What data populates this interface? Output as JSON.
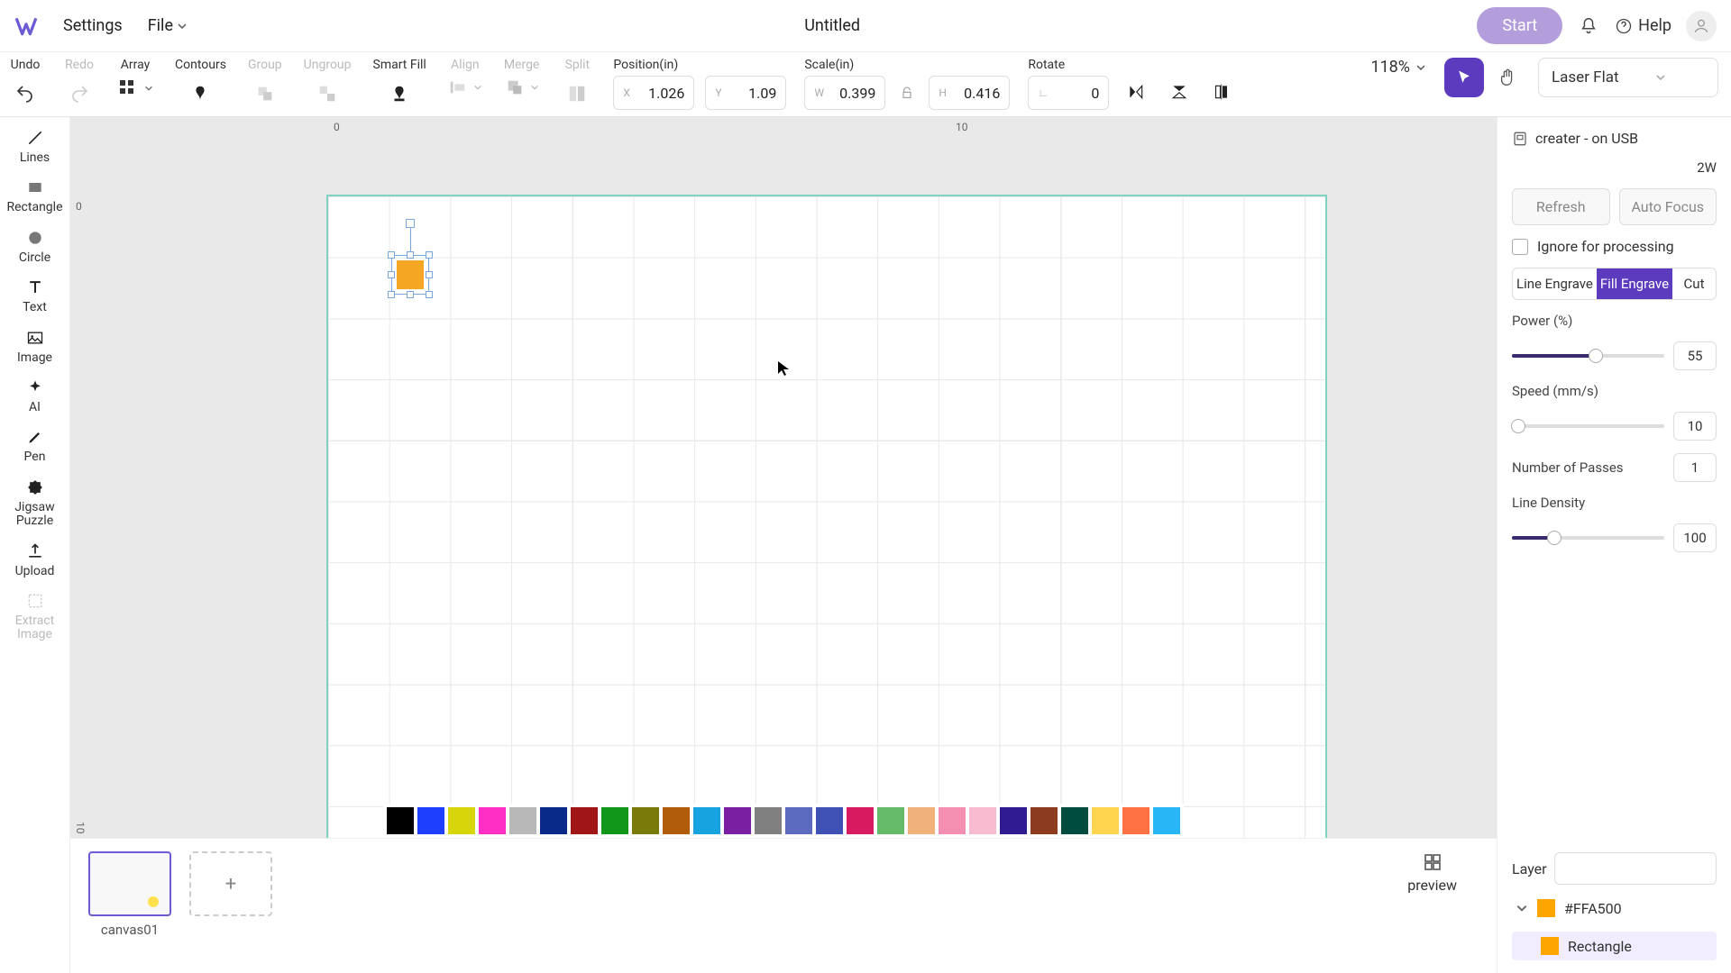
{
  "menubar": {
    "settings": "Settings",
    "file": "File",
    "title": "Untitled",
    "start": "Start",
    "help": "Help"
  },
  "toolbar": {
    "undo": "Undo",
    "redo": "Redo",
    "array": "Array",
    "contours": "Contours",
    "group": "Group",
    "ungroup": "Ungroup",
    "smart_fill": "Smart Fill",
    "align": "Align",
    "merge": "Merge",
    "split": "Split",
    "position_label": "Position(in)",
    "x_prefix": "X",
    "x_value": "1.026",
    "y_prefix": "Y",
    "y_value": "1.09",
    "scale_label": "Scale(in)",
    "w_prefix": "W",
    "w_value": "0.399",
    "h_prefix": "H",
    "h_value": "0.416",
    "rotate_label": "Rotate",
    "rot_value": "0",
    "zoom": "118%",
    "laser_mode": "Laser Flat"
  },
  "left_tools": {
    "lines": "Lines",
    "rectangle": "Rectangle",
    "circle": "Circle",
    "text": "Text",
    "image": "Image",
    "ai": "AI",
    "pen": "Pen",
    "jigsaw": "Jigsaw\nPuzzle",
    "upload": "Upload",
    "extract": "Extract\nImage"
  },
  "ruler": {
    "zero": "0",
    "ten": "10"
  },
  "palette": [
    "#000000",
    "#1f3fff",
    "#d6d60a",
    "#ff2ec4",
    "#b8b8b8",
    "#0a2a8a",
    "#a01515",
    "#109618",
    "#7a7a0a",
    "#b05c0a",
    "#17a2e0",
    "#7b1fa2",
    "#808080",
    "#5c6bc0",
    "#3f51b5",
    "#d81b60",
    "#66bb6a",
    "#f0b27a",
    "#f48fb1",
    "#f8bbd0",
    "#311b92",
    "#8d3b1f",
    "#004d40",
    "#ffd54f",
    "#ff7043",
    "#29b6f6"
  ],
  "bottom": {
    "canvas_name": "canvas01",
    "preview": "preview"
  },
  "right": {
    "device": "creater - on USB",
    "watt": "2W",
    "refresh": "Refresh",
    "auto_focus": "Auto Focus",
    "ignore": "Ignore for processing",
    "tab_line": "Line Engrave",
    "tab_fill": "Fill Engrave",
    "tab_cut": "Cut",
    "power_label": "Power (%)",
    "power_value": "55",
    "speed_label": "Speed (mm/s)",
    "speed_value": "10",
    "passes_label": "Number of Passes",
    "passes_value": "1",
    "density_label": "Line Density",
    "density_value": "100",
    "layer_label": "Layer",
    "layer_color_name": "#FFA500",
    "layer_obj_name": "Rectangle",
    "layer_color": "#FFA500"
  }
}
